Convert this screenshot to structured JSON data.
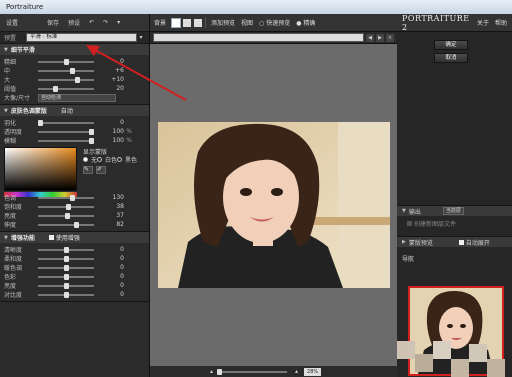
{
  "window": {
    "title": "Portraiture"
  },
  "left_panel": {
    "top": {
      "settings": "设置",
      "save": "保存",
      "restore": "预设"
    },
    "preset": {
      "label": "预置",
      "value": "平滑 : 标准"
    },
    "detail": {
      "title": "细节平滑",
      "sliders": [
        {
          "label": "精细",
          "value": "0",
          "knob": 0.5
        },
        {
          "label": "中",
          "value": "+6",
          "knob": 0.62
        },
        {
          "label": "大",
          "value": "+10",
          "knob": 0.72
        },
        {
          "label": "阈值",
          "value": "20",
          "knob": 0.3
        }
      ],
      "size_label": "大像/尺寸",
      "size_value": "自动检测"
    },
    "skin": {
      "title": "皮肤色调蒙版",
      "mode": "自动",
      "sliders": [
        {
          "label": "羽化",
          "value": "0",
          "unit": "",
          "knob": 0.0
        },
        {
          "label": "透明度",
          "value": "100",
          "unit": "%",
          "knob": 1.0
        },
        {
          "label": "模糊",
          "value": "100",
          "unit": "%",
          "knob": 1.0
        }
      ],
      "mask_title": "显示蒙版",
      "mask_options": [
        {
          "label": "无",
          "on": true
        },
        {
          "label": "白色",
          "on": false
        },
        {
          "label": "黑色",
          "on": false
        }
      ],
      "color_sliders": [
        {
          "label": "色调",
          "value": "130",
          "knob": 0.62
        },
        {
          "label": "饱和度",
          "value": "38",
          "knob": 0.55
        },
        {
          "label": "亮度",
          "value": "37",
          "knob": 0.52
        },
        {
          "label": "伸度",
          "value": "82",
          "knob": 0.7
        }
      ]
    },
    "enhance": {
      "title": "增强功能",
      "use_label": "使用增强",
      "sliders": [
        {
          "label": "清晰度",
          "value": "0"
        },
        {
          "label": "柔和度",
          "value": "0"
        },
        {
          "label": "暖色调",
          "value": "0"
        },
        {
          "label": "色彩",
          "value": "0"
        },
        {
          "label": "亮度",
          "value": "0"
        },
        {
          "label": "对比度",
          "value": "0"
        }
      ]
    }
  },
  "toolbar": {
    "back": "背景",
    "add_preview": "添加预览",
    "view": "视图",
    "fast_preview": "快速预览",
    "precise": "精确"
  },
  "bottombar": {
    "zoom": "28%"
  },
  "right_panel": {
    "logo": "PORTRAITURE 2",
    "about": "关于",
    "help": "帮助",
    "ok": "确定",
    "cancel": "取消",
    "output_title": "输出",
    "output_value": "当前层",
    "output_note": "创建新图层文件",
    "preview_title": "蒙版预览",
    "auto_expand": "自动展开",
    "nav_title": "导航"
  },
  "colors": {
    "accent": "#d21f1f",
    "panel": "#2b2b2b",
    "canvas": "#6b6b6b"
  }
}
